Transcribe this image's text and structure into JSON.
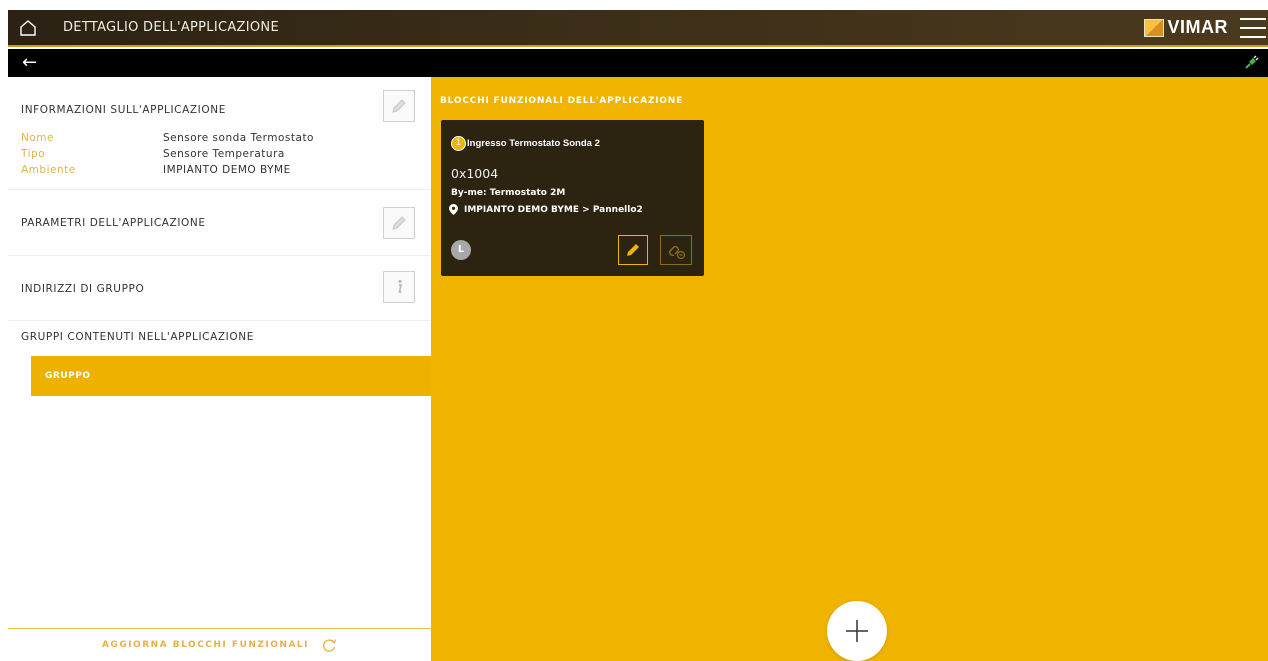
{
  "header": {
    "title": "DETTAGLIO DELL'APPLICAZIONE",
    "brand": "VIMAR",
    "home_icon": "home-icon",
    "menu_icon": "hamburger-menu-icon"
  },
  "subheader": {
    "back_icon": "back-arrow-icon",
    "back_glyph": "←",
    "status_icon": "plug-connected-icon"
  },
  "left_panel": {
    "info_section": {
      "title": "INFORMAZIONI SULL'APPLICAZIONE",
      "rows": [
        {
          "key": "Nome",
          "value": "Sensore sonda Termostato"
        },
        {
          "key": "Tipo",
          "value": "Sensore Temperatura"
        },
        {
          "key": "Ambiente",
          "value": "IMPIANTO DEMO BYME"
        }
      ]
    },
    "params_section": {
      "title": "PARAMETRI DELL'APPLICAZIONE"
    },
    "addresses_section": {
      "title": "INDIRIZZI DI GRUPPO"
    },
    "groups_section": {
      "title": "GRUPPI CONTENUTI NELL'APPLICAZIONE",
      "items": [
        {
          "label": "GRUPPO"
        }
      ]
    },
    "footer": {
      "label": "AGGIORNA BLOCCHI FUNZIONALI"
    }
  },
  "right_panel": {
    "heading": "BLOCCHI FUNZIONALI DELL'APPLICAZIONE",
    "blocks": [
      {
        "number": "1",
        "name": "Ingresso Termostato Sonda 2",
        "address": "0x1004",
        "device": "By-me: Termostato 2M",
        "location": "IMPIANTO DEMO BYME > Pannello2",
        "badge": "L"
      }
    ]
  },
  "colors": {
    "accent": "#efb300",
    "header_bg": "#3a2d17",
    "card_bg": "#2c2311",
    "label_orange": "#e5b14b"
  }
}
